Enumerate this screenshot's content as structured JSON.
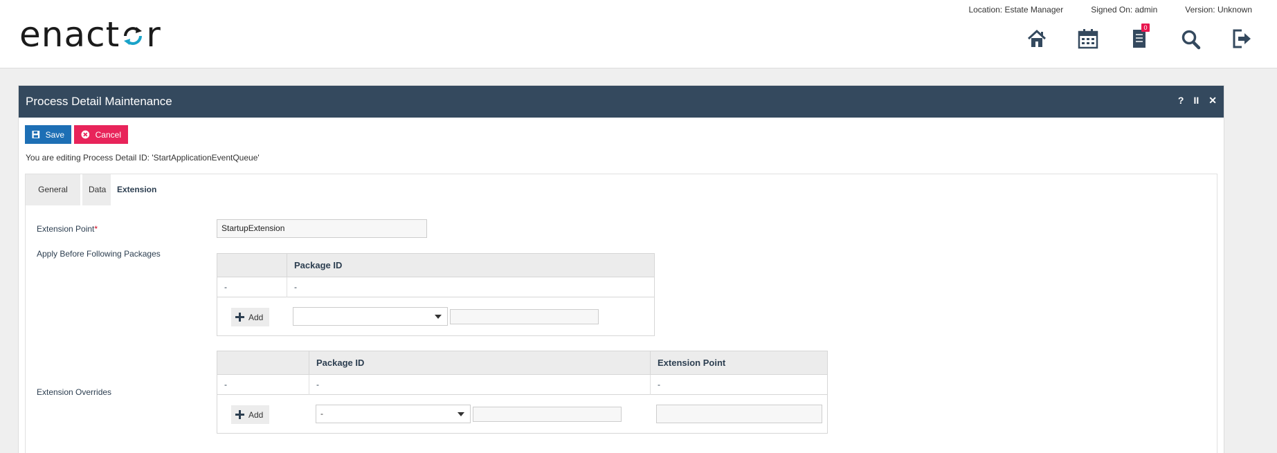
{
  "header": {
    "logo_text_left": "enact",
    "logo_text_right": "r",
    "location": "Location: Estate Manager",
    "signed_on": "Signed On: admin",
    "version": "Version: Unknown",
    "notification_count": "0",
    "accent_color": "#1aa3c9"
  },
  "window": {
    "title": "Process Detail Maintenance",
    "help": "?",
    "pause": "II",
    "close": "✕"
  },
  "toolbar": {
    "save_label": "Save",
    "cancel_label": "Cancel",
    "save_color": "#1d6fb5",
    "cancel_color": "#e8245a"
  },
  "edit_message": "You are editing Process Detail ID: 'StartApplicationEventQueue'",
  "tabs": [
    {
      "label": "General"
    },
    {
      "label": "Data"
    },
    {
      "label": "Extension",
      "active": true
    }
  ],
  "form": {
    "extension_point_label": "Extension Point",
    "required_mark": "*",
    "extension_point_value": "StartupExtension",
    "apply_before_label": "Apply Before Following Packages",
    "extension_overrides_label": "Extension Overrides"
  },
  "apply_before_grid": {
    "columns": [
      "",
      "Package ID"
    ],
    "rows": [
      [
        "-",
        "-"
      ]
    ],
    "add_label": "Add",
    "select_value": ""
  },
  "overrides_grid": {
    "columns": [
      "",
      "Package ID",
      "Extension Point"
    ],
    "rows": [
      [
        "-",
        "-",
        "-"
      ]
    ],
    "add_label": "Add",
    "select_value": "-"
  }
}
